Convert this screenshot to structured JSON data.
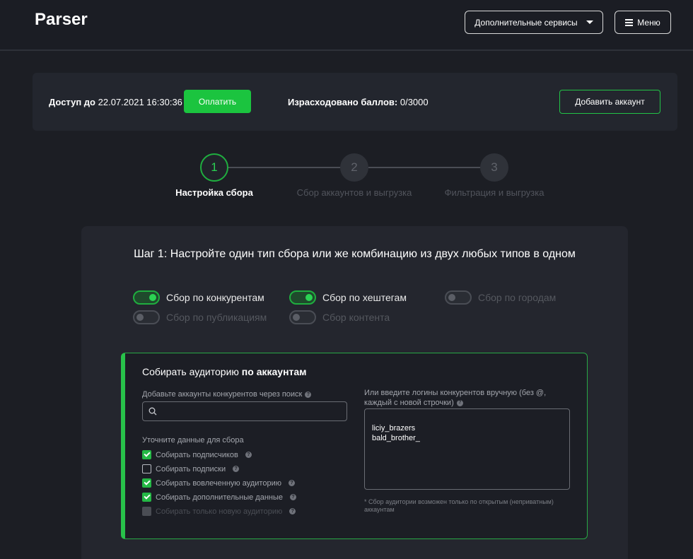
{
  "header": {
    "logo": "Parser",
    "services_label": "Дополнительные сервисы",
    "menu_label": "Меню"
  },
  "access": {
    "prefix": "Доступ до",
    "until": "22.07.2021 16:30:36",
    "pay_label": "Оплатить",
    "points_label": "Израсходовано баллов:",
    "points_value": "0/3000",
    "add_account_label": "Добавить аккаунт"
  },
  "steps": [
    {
      "number": "1",
      "label": "Настройка сбора",
      "active": true
    },
    {
      "number": "2",
      "label": "Сбор аккаунтов и выгрузка",
      "active": false
    },
    {
      "number": "3",
      "label": "Фильтрация и выгрузка",
      "active": false
    }
  ],
  "step1": {
    "title": "Шаг 1: Настройте один тип сбора или же комбинацию из двух любых типов в одном",
    "toggles": [
      {
        "label": "Сбор по конкурентам",
        "on": true
      },
      {
        "label": "Сбор по хештегам",
        "on": true
      },
      {
        "label": "Сбор по городам",
        "on": false
      },
      {
        "label": "Сбор по публикациям",
        "on": false
      },
      {
        "label": "Сбор контента",
        "on": false
      }
    ]
  },
  "audience": {
    "title_prefix": "Собирать аудиторию",
    "title_bold": "по аккаунтам",
    "search_label": "Добавьте аккаунты конкурентов через поиск",
    "search_value": "",
    "refine_label": "Уточните данные для сбора",
    "checkboxes": [
      {
        "label": "Собирать подписчиков",
        "state": "checked"
      },
      {
        "label": "Собирать подписки",
        "state": "unchecked"
      },
      {
        "label": "Собирать вовлеченную аудиторию",
        "state": "checked"
      },
      {
        "label": "Собирать дополнительные данные",
        "state": "checked"
      },
      {
        "label": "Собирать только новую аудиторию",
        "state": "disabled"
      }
    ],
    "manual_label": "Или введите логины конкурентов вручную (без @, каждый с новой строчки)",
    "manual_entries": [
      "liciy_brazers",
      "bald_brother_"
    ],
    "note": "* Сбор аудитории возможен только по открытым (неприватным) аккаунтам"
  },
  "colors": {
    "accent": "#1bc43f",
    "background": "#1c1e24",
    "panel": "#23262e"
  }
}
